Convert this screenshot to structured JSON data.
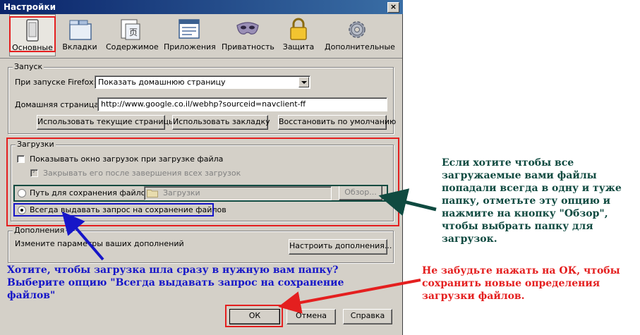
{
  "window": {
    "title": "Настройки",
    "close_glyph": "×"
  },
  "toolbar": [
    {
      "label": "Основные",
      "icon": "switch-icon"
    },
    {
      "label": "Вкладки",
      "icon": "tabs-icon"
    },
    {
      "label": "Содержимое",
      "icon": "content-icon"
    },
    {
      "label": "Приложения",
      "icon": "applications-icon"
    },
    {
      "label": "Приватность",
      "icon": "mask-icon"
    },
    {
      "label": "Защита",
      "icon": "lock-icon"
    },
    {
      "label": "Дополнительные",
      "icon": "gear-icon"
    }
  ],
  "startup": {
    "group_label": "Запуск",
    "when_starts_label": "При запуске Firefox:",
    "when_starts_value": "Показать домашнюю страницу",
    "homepage_label": "Домашняя страница:",
    "homepage_value": "http://www.google.co.il/webhp?sourceid=navclient-ff",
    "use_current_pages": "Использовать текущие страницы",
    "use_bookmark": "Использовать закладку",
    "restore_default": "Восстановить по умолчанию"
  },
  "downloads": {
    "group_label": "Загрузки",
    "show_window": "Показывать окно загрузок при загрузке файла",
    "close_when_done": "Закрывать его после завершения всех загрузок",
    "save_to": "Путь для сохранения файлов",
    "folder": "Загрузки",
    "browse": "Обзор...",
    "always_ask": "Всегда выдавать запрос на сохранение файлов"
  },
  "addons": {
    "group_label": "Дополнения",
    "description": "Измените параметры ваших дополнений",
    "manage": "Настроить дополнения..."
  },
  "dialog": {
    "ok": "ОК",
    "cancel": "Отмена",
    "help": "Справка"
  },
  "annotations": {
    "right_note": [
      "Если хотите чтобы все",
      "загружаемые вами файлы",
      "попадали всегда в одну и туже",
      "папку, отметьте эту опцию и",
      "нажмите на кнопку \"Обзор\",",
      "чтобы выбрать папку для",
      "загрузок."
    ],
    "left_note": [
      "Хотите, чтобы загрузка шла сразу в нужную вам папку?",
      "Выберите опцию \"Всегда выдавать запрос на сохранение",
      "файлов\""
    ],
    "ok_note": [
      "Не забудьте нажать на ОК, чтобы",
      "сохранить новые определения",
      "загрузки файлов."
    ],
    "colors": {
      "red": "#e41f1f",
      "blue": "#1616c8",
      "teal": "#0f4a40"
    }
  }
}
